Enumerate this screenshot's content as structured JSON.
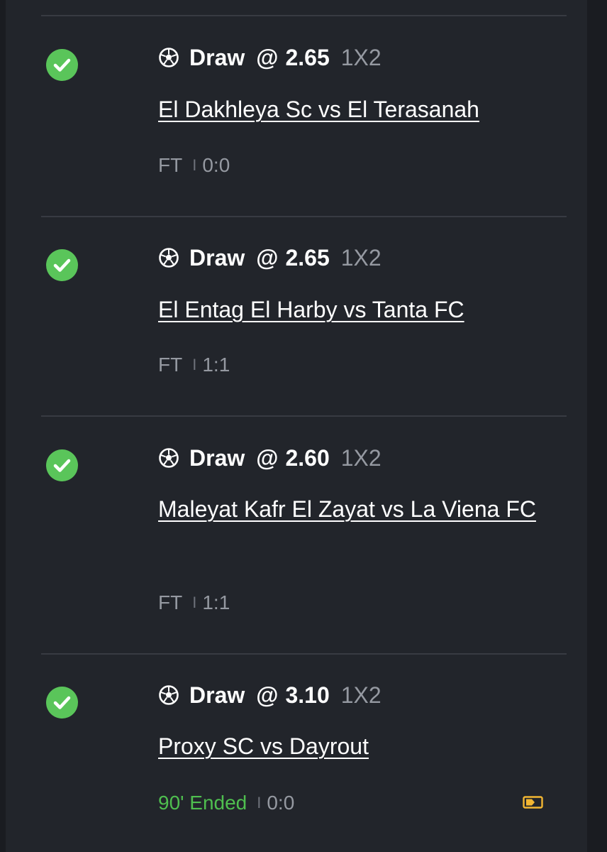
{
  "colors": {
    "background": "#22252b",
    "success": "#5ac55a",
    "live_status": "#4fbf4f",
    "muted_text": "#9599a1",
    "accent_tag": "#f2b632"
  },
  "bets": [
    {
      "icon": "soccer-ball-icon",
      "pick": "Draw",
      "at": "@",
      "odds": "2.65",
      "market": "1X2",
      "match": "El Dakhleya Sc vs El Terasanah",
      "status": "FT",
      "separator": "I",
      "score": "0:0",
      "result": "won"
    },
    {
      "icon": "soccer-ball-icon",
      "pick": "Draw",
      "at": "@",
      "odds": "2.65",
      "market": "1X2",
      "match": "El Entag El Harby vs Tanta FC",
      "status": "FT",
      "separator": "I",
      "score": "1:1",
      "result": "won"
    },
    {
      "icon": "soccer-ball-icon",
      "pick": "Draw",
      "at": "@",
      "odds": "2.60",
      "market": "1X2",
      "match": "Maleyat Kafr El Zayat vs La Viena FC",
      "status": "FT",
      "separator": "I",
      "score": "1:1",
      "result": "won"
    },
    {
      "icon": "soccer-ball-icon",
      "pick": "Draw",
      "at": "@",
      "odds": "3.10",
      "market": "1X2",
      "match": "Proxy SC vs Dayrout",
      "status": "90' Ended",
      "separator": "I",
      "score": "0:0",
      "result": "won",
      "extra_icon": "ticket-tag-icon"
    }
  ]
}
